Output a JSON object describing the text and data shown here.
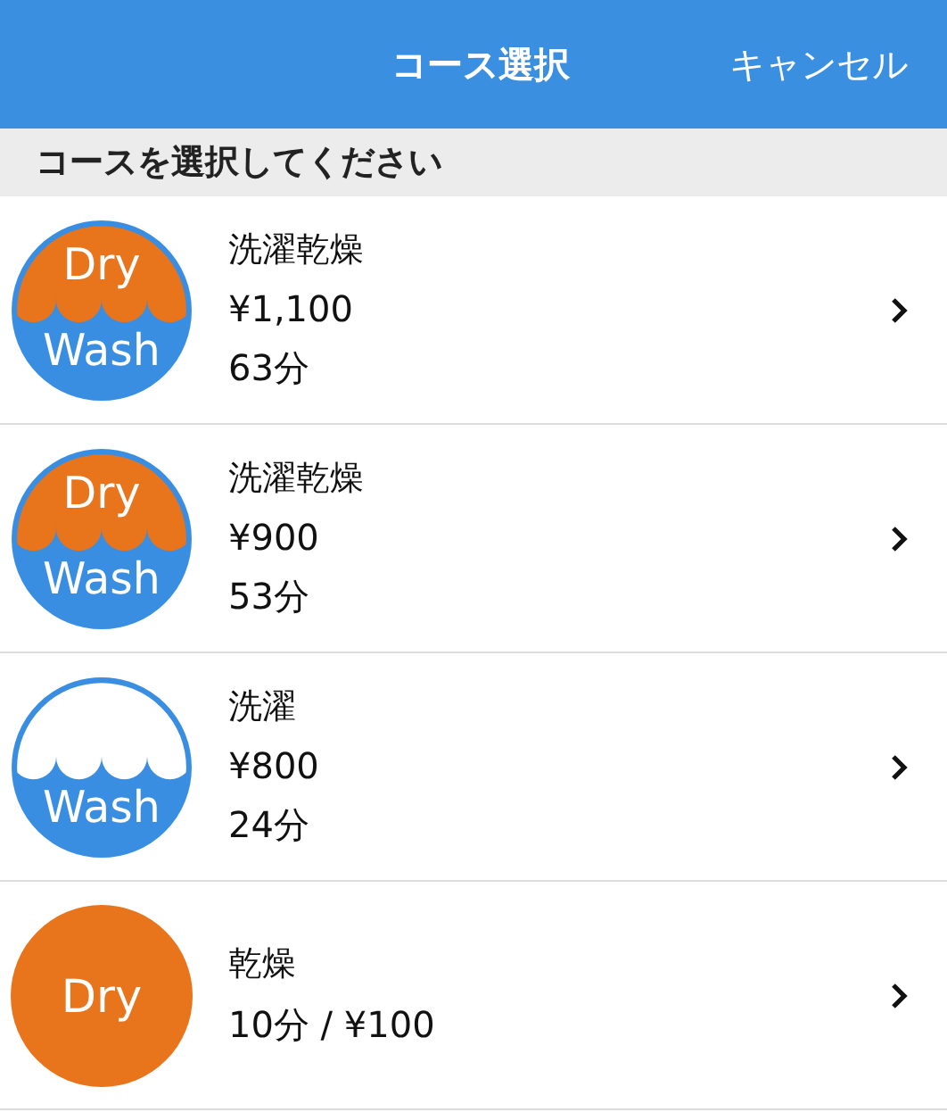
{
  "header": {
    "title": "コース選択",
    "cancel": "キャンセル"
  },
  "section": "コースを選択してください",
  "courses": [
    {
      "icon": {
        "kind": "dry-wash",
        "top": "Dry",
        "bottom": "Wash"
      },
      "name": "洗濯乾燥",
      "details": [
        "¥1,100",
        "63分"
      ]
    },
    {
      "icon": {
        "kind": "dry-wash",
        "top": "Dry",
        "bottom": "Wash"
      },
      "name": "洗濯乾燥",
      "details": [
        "¥900",
        "53分"
      ]
    },
    {
      "icon": {
        "kind": "wash",
        "bottom": "Wash"
      },
      "name": "洗濯",
      "details": [
        "¥800",
        "24分"
      ]
    },
    {
      "icon": {
        "kind": "dry",
        "center": "Dry"
      },
      "name": "乾燥",
      "details": [
        "10分 / ¥100"
      ]
    }
  ]
}
